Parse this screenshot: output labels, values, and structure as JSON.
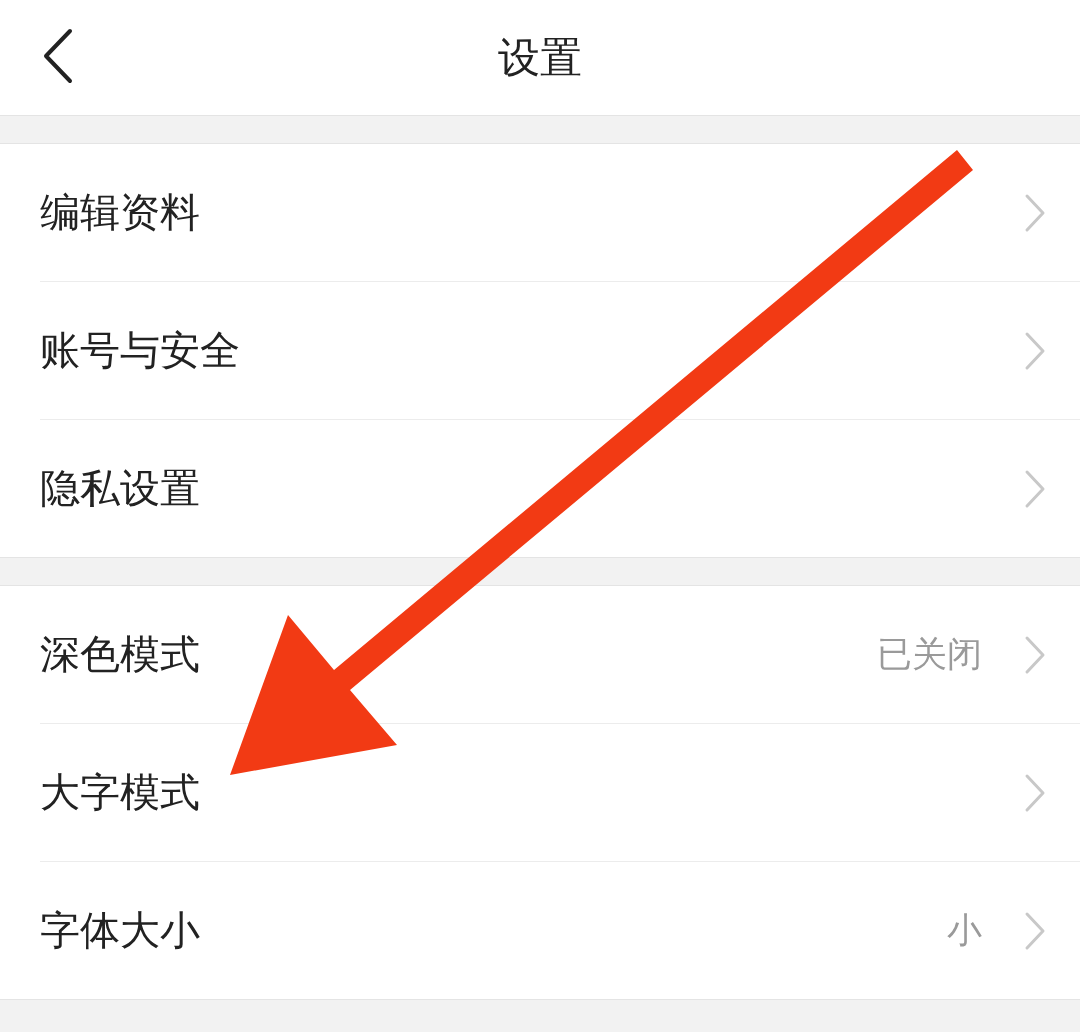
{
  "header": {
    "title": "设置"
  },
  "groups": [
    [
      {
        "label": "编辑资料"
      },
      {
        "label": "账号与安全"
      },
      {
        "label": "隐私设置"
      }
    ],
    [
      {
        "label": "深色模式",
        "value": "已关闭"
      },
      {
        "label": "大字模式"
      },
      {
        "label": "字体大小",
        "value": "小"
      }
    ]
  ]
}
